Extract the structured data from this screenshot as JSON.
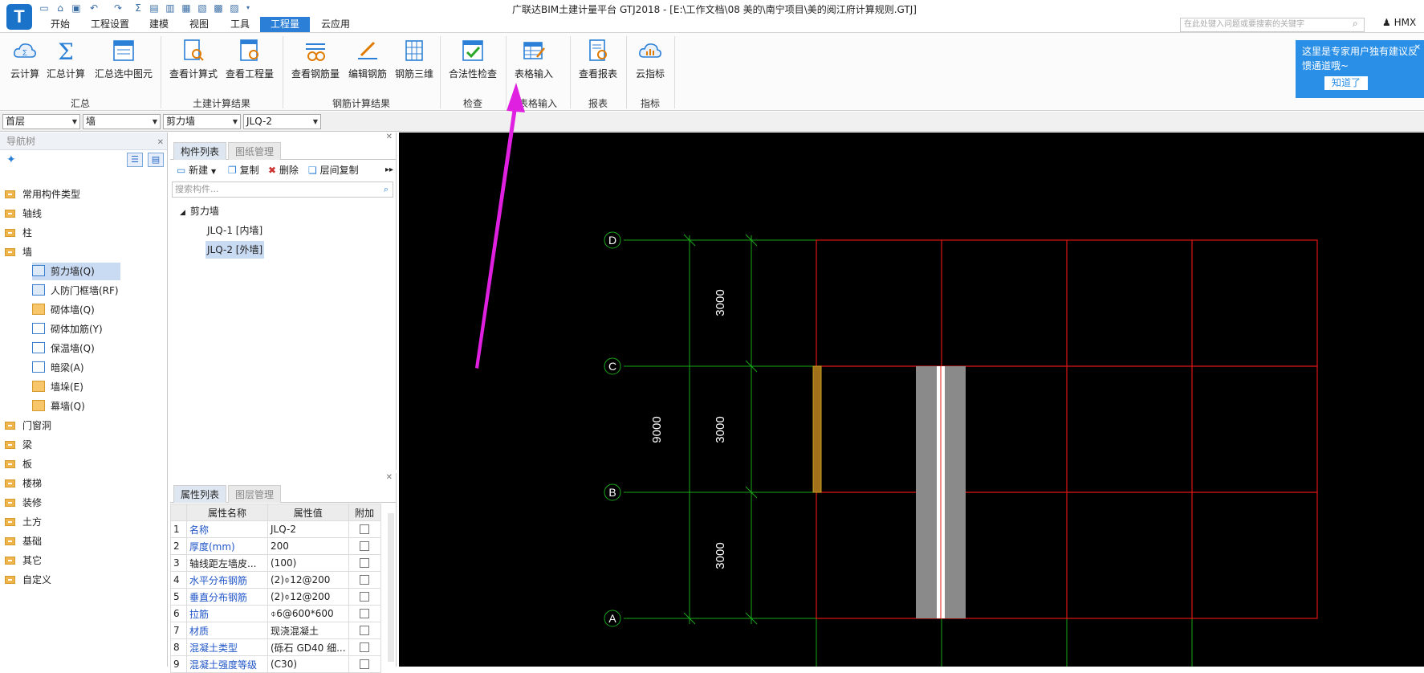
{
  "app": {
    "title": "广联达BIM土建计量平台 GTJ2018 - [E:\\工作文档\\08 美的\\南宁项目\\美的阅江府计算规则.GTJ]",
    "logo": "T",
    "search_placeholder": "在此处键入问题或要搜索的关键字",
    "user": "HMX"
  },
  "menu_tabs": [
    "开始",
    "工程设置",
    "建模",
    "视图",
    "工具",
    "工程量",
    "云应用"
  ],
  "active_tab": "工程量",
  "ribbon": {
    "buttons": [
      "云计算",
      "汇总计算",
      "汇总选中图元",
      "查看计算式",
      "查看工程量",
      "查看钢筋量",
      "编辑钢筋",
      "钢筋三维",
      "合法性检查",
      "表格输入",
      "查看报表",
      "云指标"
    ],
    "groups": [
      "汇总",
      "土建计算结果",
      "钢筋计算结果",
      "检查",
      "表格输入",
      "报表",
      "指标"
    ]
  },
  "tip": {
    "text": "这里是专家用户独有建议反馈通道哦~",
    "button": "知道了"
  },
  "selectors": [
    "首层",
    "墙",
    "剪力墙",
    "JLQ-2"
  ],
  "nav": {
    "title": "导航树",
    "items": [
      "常用构件类型",
      "轴线",
      "柱",
      "墙",
      "门窗洞",
      "梁",
      "板",
      "楼梯",
      "装修",
      "土方",
      "基础",
      "其它",
      "自定义"
    ],
    "wall_children": [
      "剪力墙(Q)",
      "人防门框墙(RF)",
      "砌体墙(Q)",
      "砌体加筋(Y)",
      "保温墙(Q)",
      "暗梁(A)",
      "墙垛(E)",
      "幕墙(Q)"
    ]
  },
  "components": {
    "tabs": [
      "构件列表",
      "图纸管理"
    ],
    "toolbar": [
      "新建",
      "复制",
      "删除",
      "层间复制"
    ],
    "search_placeholder": "搜索构件...",
    "group": "剪力墙",
    "items": [
      "JLQ-1 [内墙]",
      "JLQ-2 [外墙]"
    ]
  },
  "properties": {
    "tabs": [
      "属性列表",
      "图层管理"
    ],
    "headers": [
      "属性名称",
      "属性值",
      "附加"
    ],
    "rows": [
      {
        "no": "1",
        "name": "名称",
        "value": "JLQ-2"
      },
      {
        "no": "2",
        "name": "厚度(mm)",
        "value": "200"
      },
      {
        "no": "3",
        "name": "轴线距左墙皮...",
        "value": "(100)"
      },
      {
        "no": "4",
        "name": "水平分布钢筋",
        "value": "(2)⌽12@200"
      },
      {
        "no": "5",
        "name": "垂直分布钢筋",
        "value": "(2)⌽12@200"
      },
      {
        "no": "6",
        "name": "拉筋",
        "value": "⌽6@600*600"
      },
      {
        "no": "7",
        "name": "材质",
        "value": "现浇混凝土"
      },
      {
        "no": "8",
        "name": "混凝土类型",
        "value": "(砾石 GD40 细..."
      },
      {
        "no": "9",
        "name": "混凝土强度等级",
        "value": "(C30)"
      }
    ]
  },
  "drawing": {
    "axes": [
      "D",
      "C",
      "B",
      "A"
    ],
    "dimensions": [
      "3000",
      "3000",
      "3000"
    ],
    "total": "9000"
  },
  "colors": {
    "accent": "#2b7fd6",
    "grid_red": "#e01515",
    "dim_green": "#19a819",
    "arrow": "#e020e0"
  }
}
